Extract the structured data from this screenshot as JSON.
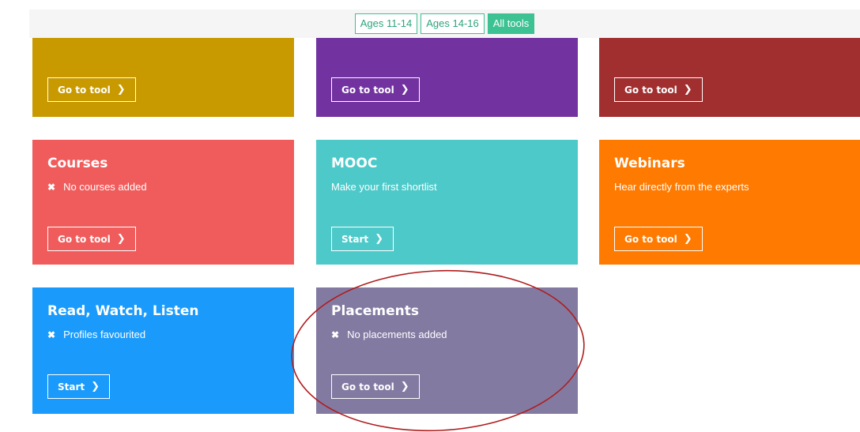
{
  "filters": [
    {
      "label": "Ages 11-14",
      "active": false
    },
    {
      "label": "Ages 14-16",
      "active": false
    },
    {
      "label": "All tools",
      "active": true
    }
  ],
  "top_row": [
    {
      "button": "Go to tool",
      "color": "#c89a00"
    },
    {
      "button": "Go to tool",
      "color": "#7233a1"
    },
    {
      "button": "Go to tool",
      "color": "#a12f2f"
    }
  ],
  "cards": {
    "courses": {
      "title": "Courses",
      "status": "No courses added",
      "button": "Go to tool",
      "color": "#f05c5c",
      "status_icon": "x-icon"
    },
    "mooc": {
      "title": "MOOC",
      "status": "Make your first shortlist",
      "button": "Start",
      "color": "#4dc9c9"
    },
    "webinars": {
      "title": "Webinars",
      "status": "Hear directly from the experts",
      "button": "Go to tool",
      "color": "#ff7a00"
    },
    "read_watch_listen": {
      "title": "Read, Watch, Listen",
      "status": "Profiles favourited",
      "button": "Start",
      "color": "#1a9bfc",
      "status_icon": "x-icon"
    },
    "placements": {
      "title": "Placements",
      "status": "No placements added",
      "button": "Go to tool",
      "color": "#837aa2",
      "status_icon": "x-icon"
    }
  },
  "annotation": {
    "shape": "ellipse",
    "color": "#b01c1c",
    "highlights": "placements"
  }
}
